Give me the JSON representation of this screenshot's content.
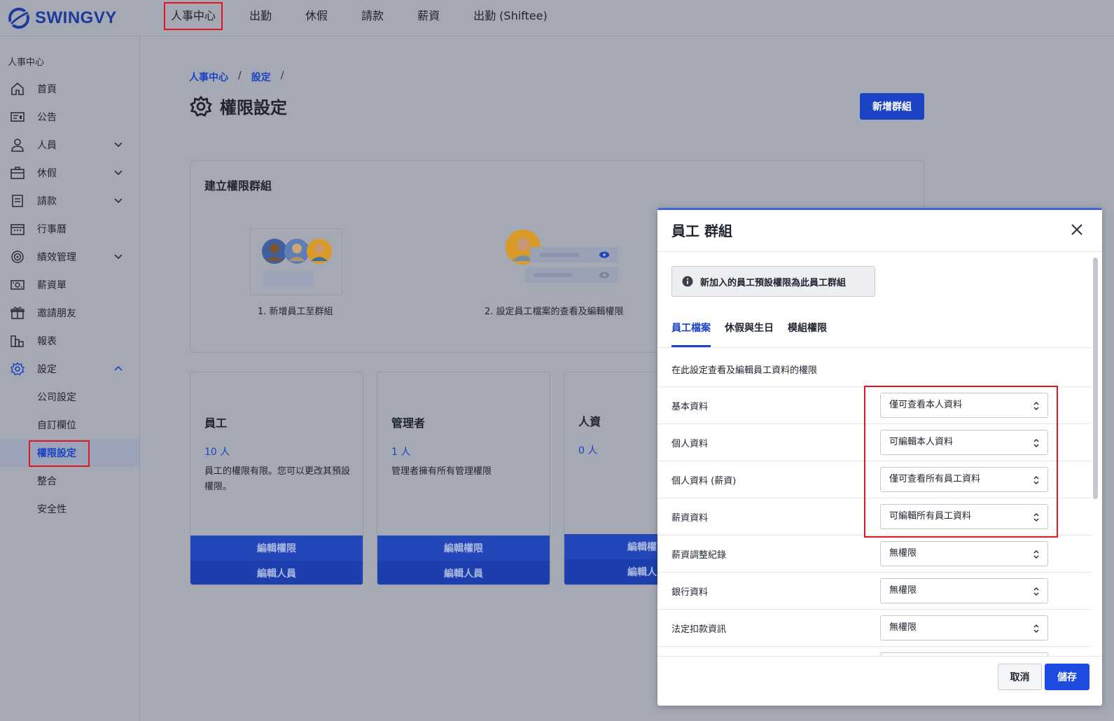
{
  "app": {
    "logo_text": "SWINGVY"
  },
  "topnav": [
    "人事中心",
    "出勤",
    "休假",
    "請款",
    "薪資",
    "出勤 (Shiftee)"
  ],
  "sidebar": {
    "section": "人事中心",
    "items": [
      {
        "label": "首頁",
        "icon": "home-icon"
      },
      {
        "label": "公告",
        "icon": "announcement-icon"
      },
      {
        "label": "人員",
        "icon": "user-icon"
      },
      {
        "label": "休假",
        "icon": "briefcase-icon"
      },
      {
        "label": "請款",
        "icon": "receipt-icon"
      },
      {
        "label": "行事曆",
        "icon": "calendar-icon"
      },
      {
        "label": "績效管理",
        "icon": "target-icon"
      },
      {
        "label": "薪資單",
        "icon": "payslip-icon"
      },
      {
        "label": "邀請朋友",
        "icon": "gift-icon"
      },
      {
        "label": "報表",
        "icon": "chart-icon"
      },
      {
        "label": "設定",
        "icon": "gear-icon"
      }
    ],
    "sub_items": [
      "公司設定",
      "自訂欄位",
      "權限設定",
      "整合",
      "安全性"
    ]
  },
  "breadcrumb": [
    "人事中心",
    "設定"
  ],
  "page": {
    "title": "權限設定",
    "add_group_button": "新增群組"
  },
  "create_section": {
    "title": "建立權限群組",
    "step1": "1. 新增員工至群組",
    "step2": "2. 設定員工檔案的查看及編輯權限"
  },
  "groups": [
    {
      "name": "員工",
      "count": "10 人",
      "desc": "員工的權限有限。您可以更改其預設權限。",
      "edit_perm": "編輯權限",
      "edit_members": "編輯人員"
    },
    {
      "name": "管理者",
      "count": "1 人",
      "desc": "管理者擁有所有管理權限",
      "edit_perm": "編輯權限",
      "edit_members": "編輯人員"
    },
    {
      "name": "人資",
      "count": "0 人",
      "desc": "",
      "edit_perm": "編輯權",
      "edit_members": "編輯人"
    }
  ],
  "modal": {
    "title": "員工 群組",
    "info": "新加入的員工預設權限為此員工群組",
    "tabs": [
      "員工檔案",
      "休假與生日",
      "模組權限"
    ],
    "description": "在此設定查看及編輯員工資料的權限",
    "rows": [
      {
        "label": "基本資料",
        "value": "僅可查看本人資料"
      },
      {
        "label": "個人資料",
        "value": "可編輯本人資料"
      },
      {
        "label": "個人資料 (薪資)",
        "value": "僅可查看所有員工資料"
      },
      {
        "label": "薪資資料",
        "value": "可編輯所有員工資料"
      },
      {
        "label": "薪資調整紀錄",
        "value": "無權限"
      },
      {
        "label": "銀行資料",
        "value": "無權限"
      },
      {
        "label": "法定扣款資訊",
        "value": "無權限"
      }
    ],
    "cancel": "取消",
    "save": "儲存"
  },
  "colors": {
    "brand": "#1c43c4",
    "highlight": "#e0181e"
  }
}
